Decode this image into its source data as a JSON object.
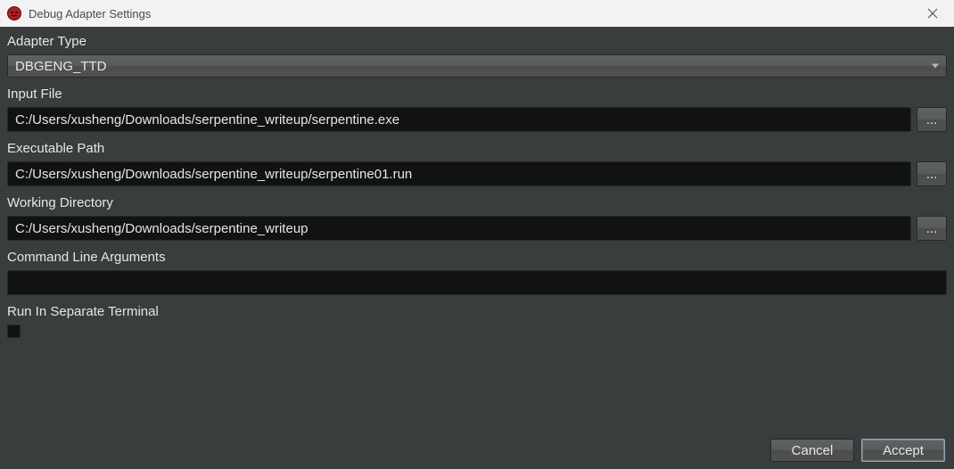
{
  "window": {
    "title": "Debug Adapter Settings"
  },
  "labels": {
    "adapter_type": "Adapter Type",
    "input_file": "Input File",
    "executable_path": "Executable Path",
    "working_directory": "Working Directory",
    "command_line_arguments": "Command Line Arguments",
    "run_in_separate_terminal": "Run In Separate Terminal"
  },
  "fields": {
    "adapter_type": {
      "value": "DBGENG_TTD"
    },
    "input_file": {
      "value": "C:/Users/xusheng/Downloads/serpentine_writeup/serpentine.exe"
    },
    "executable_path": {
      "value": "C:/Users/xusheng/Downloads/serpentine_writeup/serpentine01.run"
    },
    "working_directory": {
      "value": "C:/Users/xusheng/Downloads/serpentine_writeup"
    },
    "command_line_arguments": {
      "value": ""
    },
    "run_in_separate_terminal": {
      "checked": false
    }
  },
  "buttons": {
    "browse": "...",
    "cancel": "Cancel",
    "accept": "Accept"
  },
  "icons": {
    "app": "app-icon",
    "close": "close-icon",
    "dropdown": "chevron-down-icon"
  }
}
